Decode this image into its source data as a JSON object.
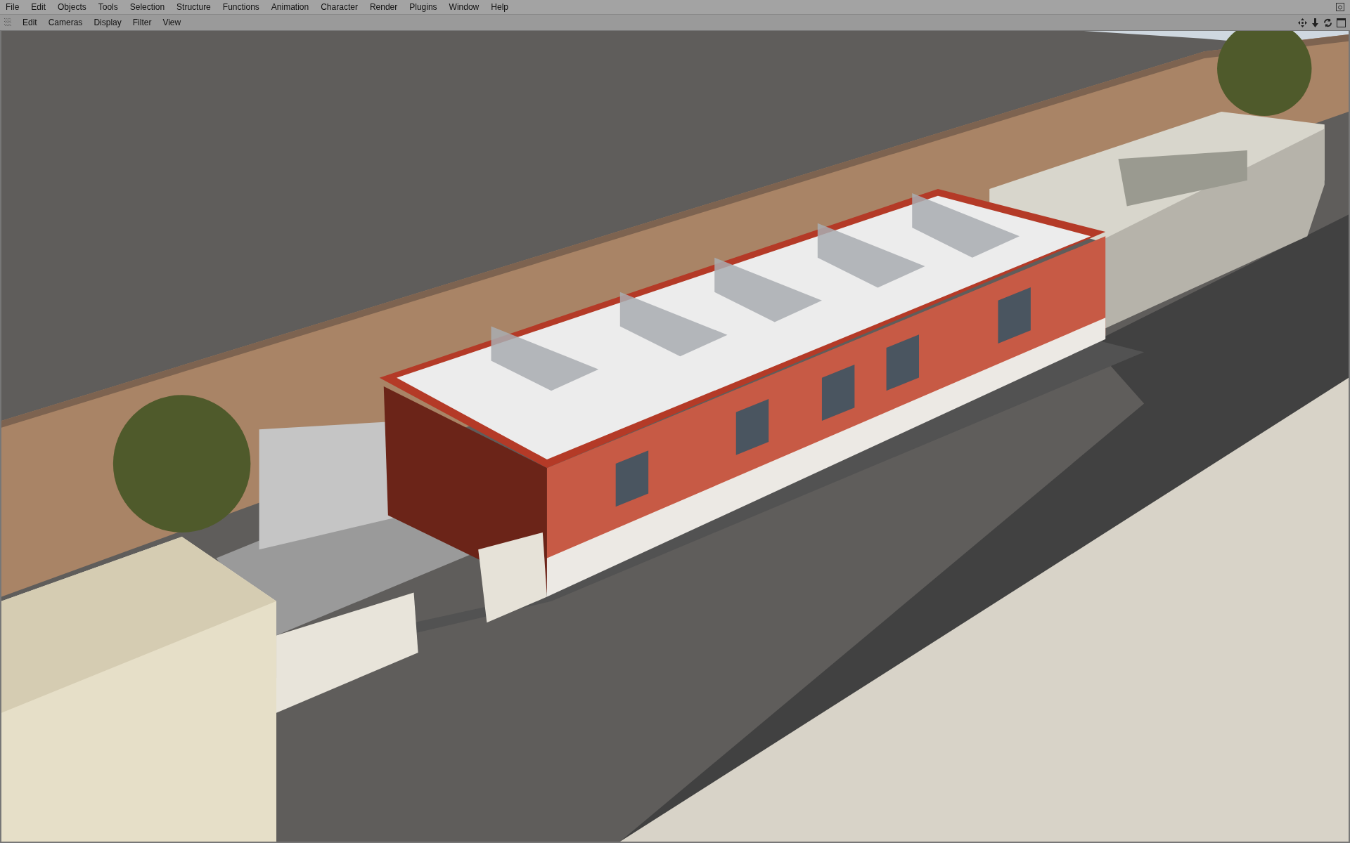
{
  "menu_bar": {
    "items": [
      "File",
      "Edit",
      "Objects",
      "Tools",
      "Selection",
      "Structure",
      "Functions",
      "Animation",
      "Character",
      "Render",
      "Plugins",
      "Window",
      "Help"
    ]
  },
  "viewport": {
    "menu_items": [
      "Edit",
      "Cameras",
      "Display",
      "Filter",
      "View"
    ]
  }
}
